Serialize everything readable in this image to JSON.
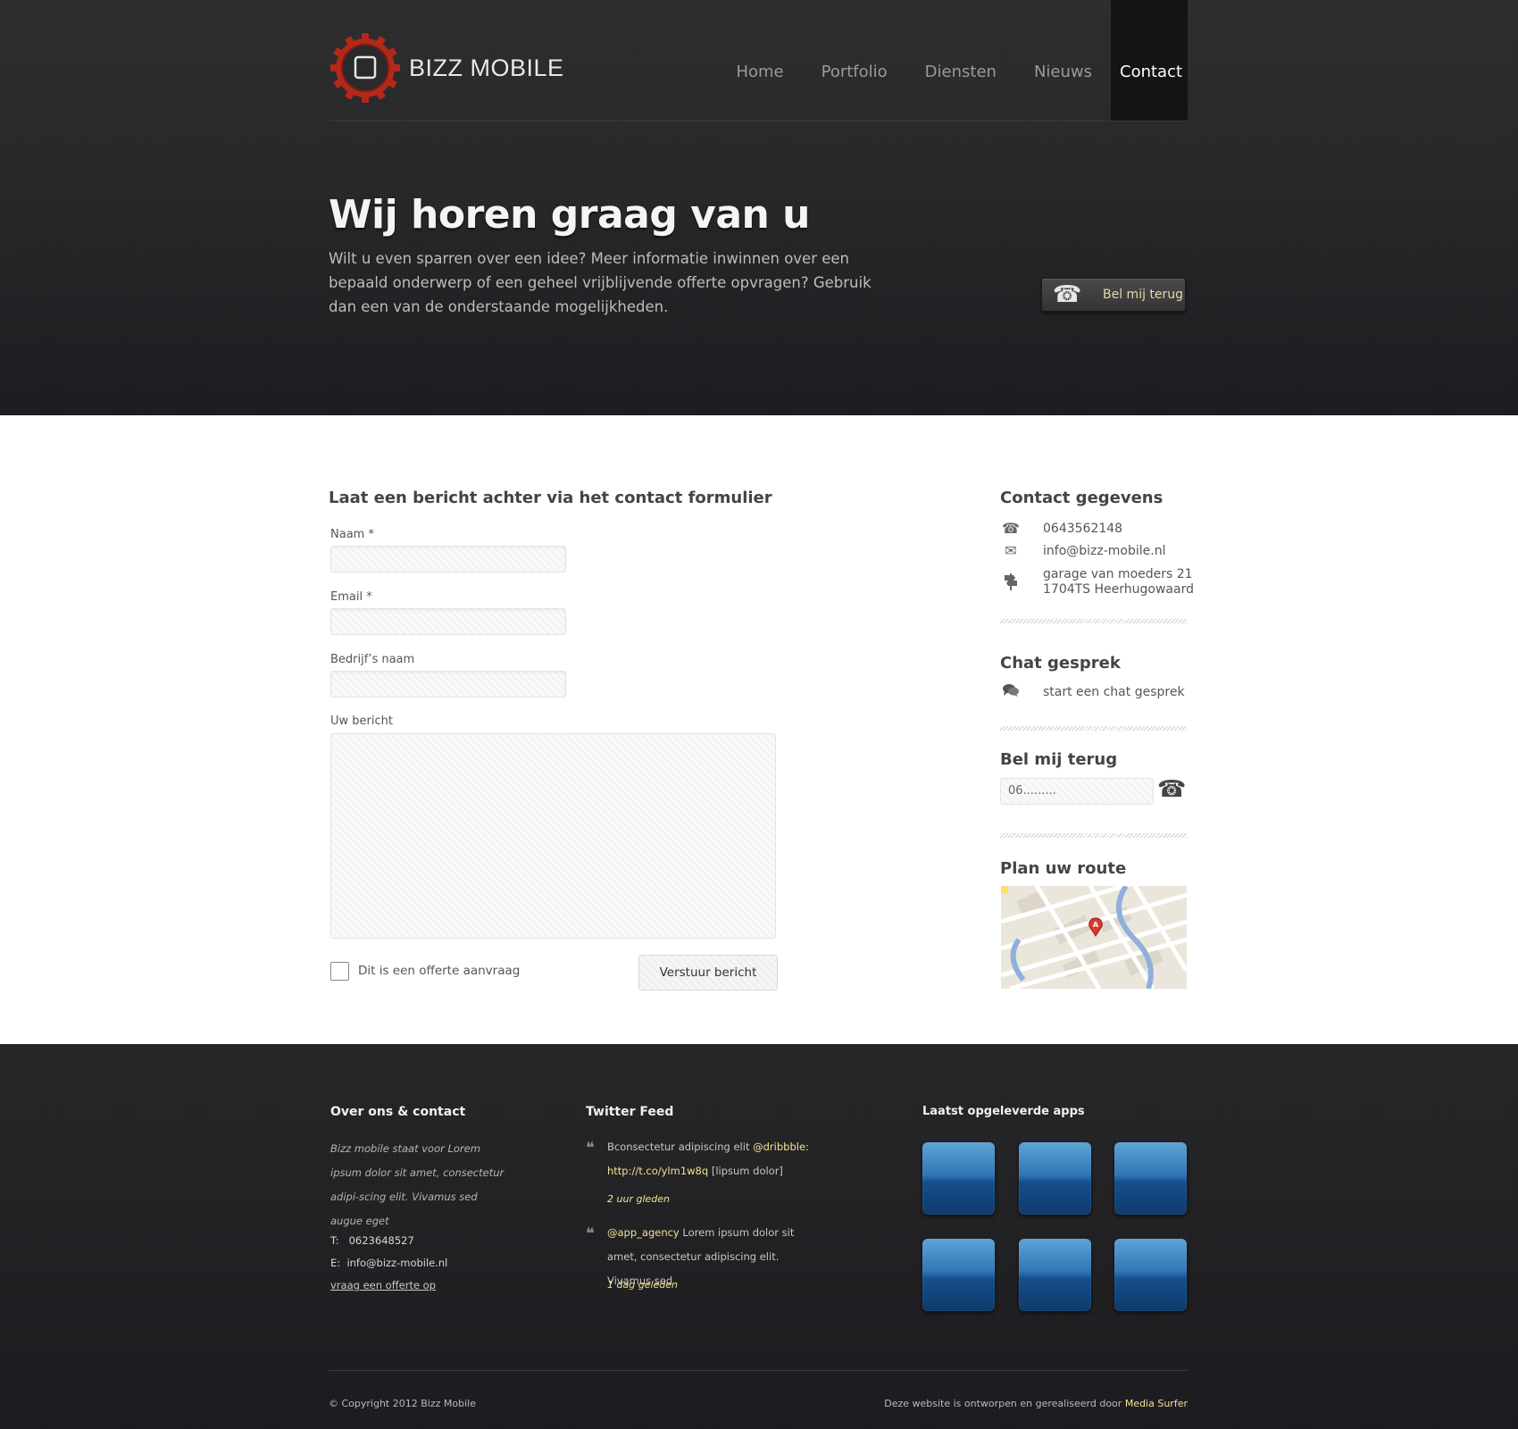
{
  "header": {
    "brand": "BIZZ MOBILE",
    "nav": [
      "Home",
      "Portfolio",
      "Diensten",
      "Nieuws",
      "Contact"
    ],
    "active_nav": "Contact"
  },
  "hero": {
    "title": "Wij horen graag van u",
    "text": "Wilt u even sparren over een idee? Meer informatie inwinnen over een bepaald onderwerp of een geheel vrijblijvende offerte opvragen? Gebruik dan een van de onderstaande mogelijkheden.",
    "callback_button": "Bel mij terug"
  },
  "form": {
    "title": "Laat een bericht achter via het contact formulier",
    "name_label": "Naam *",
    "email_label": "Email *",
    "company_label": "Bedrijf’s naam",
    "message_label": "Uw bericht",
    "quote_checkbox_label": "Dit is een offerte aanvraag",
    "submit_label": "Verstuur bericht"
  },
  "sidebar": {
    "contact_title": "Contact gegevens",
    "phone": "0643562148",
    "email": "info@bizz-mobile.nl",
    "address_line1": "garage van moeders 21",
    "address_line2": "1704TS Heerhugowaard",
    "chat_title": "Chat gesprek",
    "chat_link": "start een chat gesprek",
    "callback_title": "Bel mij terug",
    "callback_value": "06.........",
    "route_title": "Plan uw route",
    "map_marker": "A"
  },
  "footer": {
    "about_title": "Over ons & contact",
    "about_text": "Bizz mobile staat voor Lorem ipsum dolor sit amet, consectetur adipi-scing elit. Vivamus sed augue eget",
    "phone_label": "T:",
    "phone": "0623648527",
    "email_label": "E:",
    "email": "info@bizz-mobile.nl",
    "quote_link": "vraag een offerte op",
    "twitter_title": "Twitter Feed",
    "tweets": [
      {
        "pre": "Bconsectetur adipiscing elit ",
        "handle": "@dribbble:",
        "link": "http://t.co/ylm1w8q",
        "post": " [lipsum dolor]",
        "time": "2 uur gleden"
      },
      {
        "handle": "@app_agency",
        "text": " Lorem ipsum dolor sit amet, consectetur adipiscing elit. Vivamus sed",
        "time": "1 dag geleden"
      }
    ],
    "apps_title": "Laatst opgeleverde apps",
    "copyright": "© Copyright 2012 Bizz Mobile",
    "credit_text": "Deze website is ontworpen en gerealiseerd door ",
    "credit_link": "Media Surfer"
  },
  "colors": {
    "accent_red": "#c0301c",
    "link_yellow": "#f3e18f",
    "app_blue": "#2f77b6"
  }
}
